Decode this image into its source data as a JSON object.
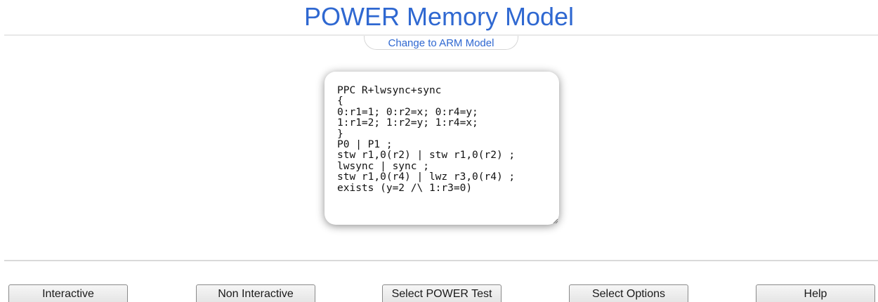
{
  "header": {
    "title": "POWER Memory Model",
    "switch_model_label": "Change to ARM Model"
  },
  "editor": {
    "content": "PPC R+lwsync+sync\n{\n0:r1=1; 0:r2=x; 0:r4=y;\n1:r1=2; 1:r2=y; 1:r4=x;\n}\nP0 | P1 ;\nstw r1,0(r2) | stw r1,0(r2) ;\nlwsync | sync ;\nstw r1,0(r4) | lwz r3,0(r4) ;\nexists (y=2 /\\ 1:r3=0)"
  },
  "toolbar": {
    "interactive_label": "Interactive",
    "non_interactive_label": "Non Interactive",
    "select_test_label": "Select POWER Test",
    "select_options_label": "Select Options",
    "help_label": "Help"
  },
  "colors": {
    "accent": "#2f68d1"
  }
}
